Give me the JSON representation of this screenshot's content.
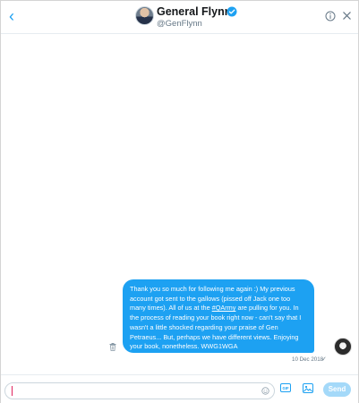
{
  "header": {
    "back_glyph": "‹",
    "name": "General Flynn",
    "handle": "@GenFlynn"
  },
  "message": {
    "text_before_tag": "Thank you so much for following me again :)  My previous account got sent to the gallows (pissed off Jack one too many times). All of us at the ",
    "tag": "#QArmy",
    "text_after_tag": " are pulling for you. In the process of reading your book right now - can't say that I wasn't a little shocked regarding your praise of Gen Petraeus... But, perhaps we have different views. Enjoying your book, nonetheless. WWG1WGA",
    "timestamp": "10 Dec 2018",
    "check_glyph": "✓"
  },
  "composer": {
    "placeholder": "",
    "gif_label": "GIF",
    "send_label": "Send"
  },
  "colors": {
    "accent": "#1da1f2",
    "send_disabled": "#a4d9f9"
  }
}
